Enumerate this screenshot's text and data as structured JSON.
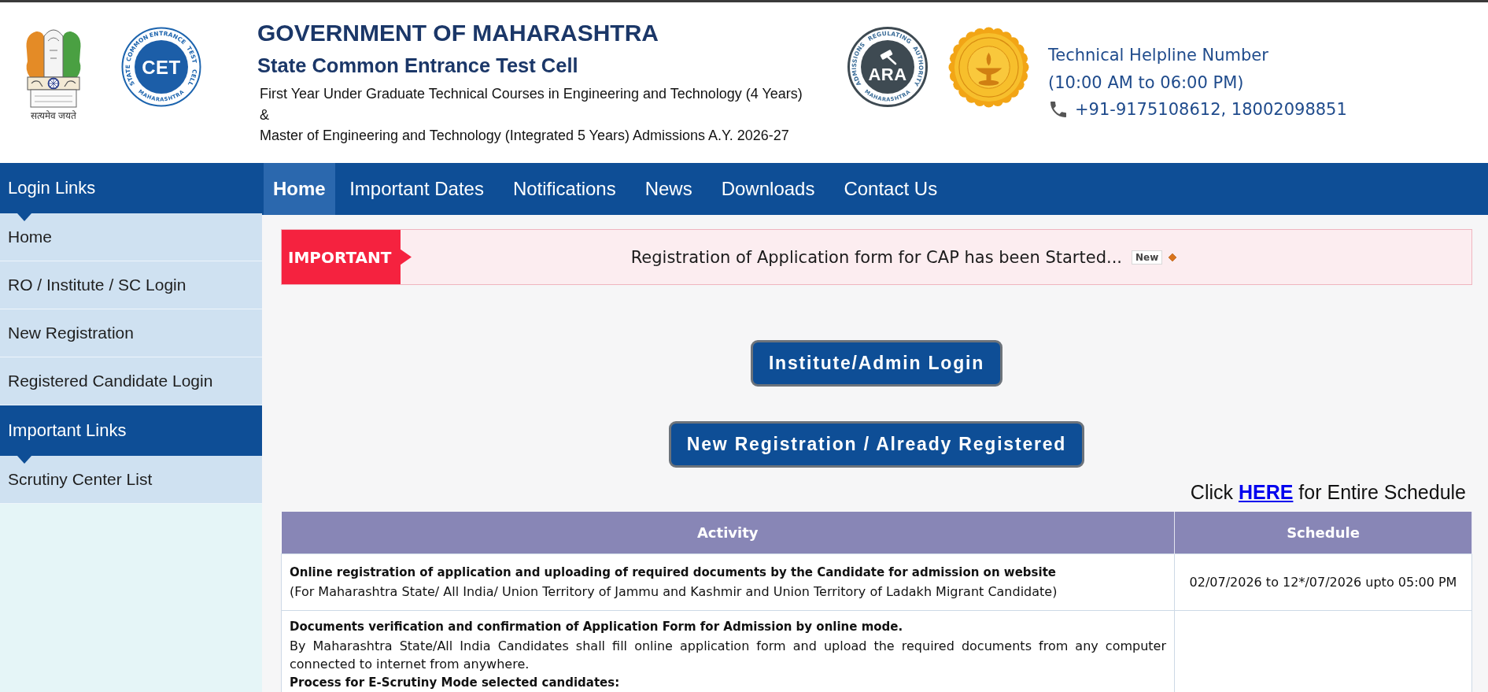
{
  "header": {
    "emblem": {
      "motto": "सत्यमेव जयते"
    },
    "cet_logo": {
      "mark": "CET",
      "ring_words": [
        "STATE",
        "COMMON",
        "ENTRANCE",
        "TEST",
        "CELL"
      ],
      "bottom_text": "MAHARASHTRA"
    },
    "title": "GOVERNMENT OF MAHARASHTRA",
    "subtitle": "State Common Entrance Test Cell",
    "description": [
      "First Year Under Graduate Technical Courses in Engineering and Technology (4 Years)",
      "&",
      "Master of Engineering and Technology (Integrated 5 Years) Admissions A.Y. 2026-27"
    ],
    "ara_logo": {
      "mark": "ARA",
      "ring_words": [
        "ADMISSIONS",
        "REGULATING",
        "AUTHORITY"
      ],
      "bottom_text": "MAHARASHTRA"
    },
    "helpline": {
      "title": "Technical Helpline Number",
      "hours": "(10:00 AM to 06:00 PM)",
      "phone": "+91-9175108612, 18002098851"
    }
  },
  "sidebar": {
    "sections": [
      {
        "heading": "Login Links",
        "items": [
          "Home",
          "RO / Institute / SC Login",
          "New Registration",
          "Registered Candidate Login"
        ]
      },
      {
        "heading": "Important Links",
        "items": [
          "Scrutiny Center List"
        ]
      }
    ]
  },
  "nav": {
    "tabs": [
      {
        "label": "Home",
        "selected": true
      },
      {
        "label": "Important Dates",
        "selected": false
      },
      {
        "label": "Notifications",
        "selected": false
      },
      {
        "label": "News",
        "selected": false
      },
      {
        "label": "Downloads",
        "selected": false
      },
      {
        "label": "Contact Us",
        "selected": false
      }
    ]
  },
  "notice": {
    "tag": "IMPORTANT",
    "message": "Registration of Application form for CAP has been Started...",
    "badge": "New"
  },
  "actions": [
    "Institute/Admin Login",
    "New Registration / Already Registered"
  ],
  "schedule_link": {
    "before": "Click",
    "link": "HERE",
    "after": "for Entire Schedule"
  },
  "table": {
    "columns": [
      "Activity",
      "Schedule"
    ],
    "rows": [
      {
        "activity": [
          {
            "kind": "heading",
            "text": "Online registration of application and uploading of required documents by the Candidate for admission on website"
          },
          {
            "kind": "text",
            "text": "(For Maharashtra State/ All India/ Union Territory of Jammu and Kashmir and Union Territory of Ladakh Migrant Candidate)"
          }
        ],
        "schedule": "02/07/2026 to 12*/07/2026 upto 05:00 PM"
      },
      {
        "activity": [
          {
            "kind": "heading",
            "text": "Documents verification and confirmation of Application Form for Admission by online mode."
          },
          {
            "kind": "text",
            "text": "By Maharashtra State/All India Candidates shall fill online application form and upload the required documents from any computer connected to internet from anywhere."
          },
          {
            "kind": "heading",
            "text": "Process for E-Scrutiny Mode selected candidates:"
          }
        ]
      }
    ]
  }
}
